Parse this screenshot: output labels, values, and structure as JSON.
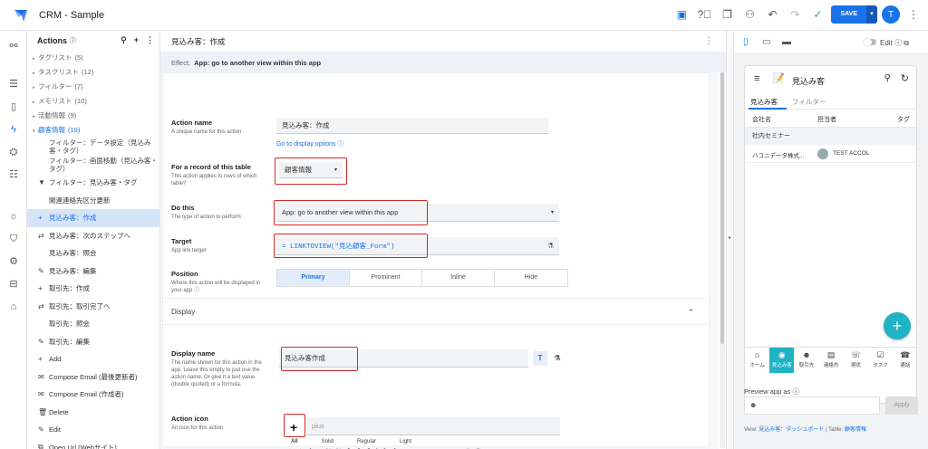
{
  "app": {
    "title": "CRM - Sample"
  },
  "topbar": {
    "save_label": "SAVE",
    "user_initial": "T",
    "icons": [
      "preview-icon",
      "help-icon",
      "copy-icon",
      "share-user-icon",
      "undo-icon",
      "redo-icon",
      "check-icon"
    ]
  },
  "actions_panel": {
    "title": "Actions",
    "tree": [
      {
        "label": "タグリスト",
        "count": "(5)"
      },
      {
        "label": "タスクリスト",
        "count": "(12)"
      },
      {
        "label": "フィルター",
        "count": "(7)"
      },
      {
        "label": "メモリスト",
        "count": "(10)"
      },
      {
        "label": "活動情報",
        "count": "(9)"
      },
      {
        "label": "顧客情報",
        "count": "(19)"
      }
    ],
    "sub_items": [
      "フィルター：データ設定（見込み客・タグ）",
      "フィルター：画面移動（見込み客・タグ）"
    ],
    "rows": [
      {
        "icon": "filter-icon",
        "label": "フィルター：見込み客・タグ"
      },
      {
        "icon": "",
        "label": "関連連絡先区分更新"
      },
      {
        "icon": "plus-icon",
        "label": "見込み客：作成"
      },
      {
        "icon": "swap-icon",
        "label": "見込み客：次のステップへ"
      },
      {
        "icon": "",
        "label": "見込み客：照会"
      },
      {
        "icon": "edit-icon",
        "label": "見込み客：編集"
      },
      {
        "icon": "plus-icon",
        "label": "取引先：作成"
      },
      {
        "icon": "swap-icon",
        "label": "取引先：取引完了へ"
      },
      {
        "icon": "",
        "label": "取引先：照会"
      },
      {
        "icon": "edit-icon",
        "label": "取引先：編集"
      },
      {
        "icon": "plus-icon",
        "label": "Add"
      },
      {
        "icon": "mail-icon",
        "label": "Compose Email (最後更新者)"
      },
      {
        "icon": "mail-icon",
        "label": "Compose Email (作成者)"
      },
      {
        "icon": "trash-icon",
        "label": "Delete"
      },
      {
        "icon": "edit-icon",
        "label": "Edit"
      },
      {
        "icon": "open-link-icon",
        "label": "Open Url (Webサイト)"
      }
    ]
  },
  "editor": {
    "title": "見込み客：作成",
    "effect_label": "Effect:",
    "effect_value": "App: go to another view within this app",
    "action_name": {
      "label": "Action name",
      "desc": "A unique name for this action",
      "value": "見込み客：作成",
      "link": "Go to display options"
    },
    "record_table": {
      "label": "For a record of this table",
      "desc": "This action applies to rows of which table?",
      "value": "顧客情報"
    },
    "do_this": {
      "label": "Do this",
      "desc": "The type of action to perform",
      "value": "App: go to another view within this app"
    },
    "target": {
      "label": "Target",
      "desc": "App link target",
      "value": "= LINKTOVIEW(\"見込顧客_Form\")"
    },
    "position": {
      "label": "Position",
      "desc": "Where this action will be displayed in your app",
      "options": [
        "Primary",
        "Prominent",
        "Inline",
        "Hide"
      ],
      "selected": "Primary"
    },
    "display_section": "Display",
    "display_name": {
      "label": "Display name",
      "desc": "The name shown for this action in the app. Leave this empty to just use the action name. Or give it a text value (double quoted) or a formula.",
      "value": "見込み客作成"
    },
    "action_icon": {
      "label": "Action icon",
      "desc": "An icon for this action",
      "value": "plus",
      "tabs": [
        "All",
        "Solid",
        "Regular",
        "Light"
      ]
    }
  },
  "preview": {
    "edit_label": "Edit",
    "screen_title": "見込み客",
    "tabs": [
      "見込み客",
      "フィルター"
    ],
    "columns": [
      "会社名",
      "担当者",
      "タグ"
    ],
    "group": "社内セミナー",
    "row": {
      "company": "ハコニデータ株式...",
      "person": "TEST ACCOL"
    },
    "nav": [
      "ホーム",
      "見込み客",
      "取引先",
      "連絡先",
      "現状",
      "タスク",
      "通話"
    ],
    "preview_as": "Preview app as",
    "apply_label": "Apply",
    "footer": {
      "view_label": "View:",
      "view_value": "見込み客：ダッシュボード",
      "table_label": "Table:",
      "table_value": "顧客情報"
    }
  }
}
